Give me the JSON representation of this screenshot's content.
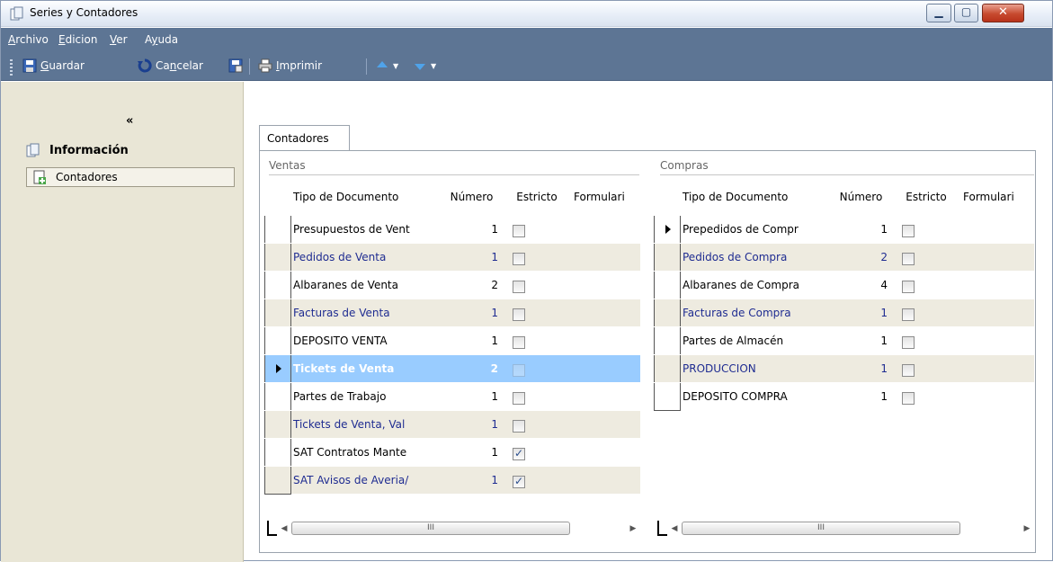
{
  "window": {
    "title": "Series y Contadores",
    "controls": {
      "minimize": "▁",
      "maximize": "▢",
      "close": "✕"
    }
  },
  "menu": [
    {
      "label_pre": "",
      "label_u": "A",
      "label_post": "rchivo"
    },
    {
      "label_pre": "",
      "label_u": "E",
      "label_post": "dicion"
    },
    {
      "label_pre": "",
      "label_u": "V",
      "label_post": "er"
    },
    {
      "label_pre": "A",
      "label_u": "y",
      "label_post": "uda"
    }
  ],
  "toolbar": {
    "guardar": {
      "u": "G",
      "rest": "uardar"
    },
    "cancelar": {
      "pre": "Ca",
      "u": "n",
      "rest": "celar"
    },
    "imprimir": {
      "u": "I",
      "rest": "mprimir"
    }
  },
  "sidebar": {
    "collapse": "«",
    "heading": "Información",
    "items": [
      "Contadores"
    ]
  },
  "tab": {
    "label": "Contadores"
  },
  "ventas": {
    "group": "Ventas",
    "headers": [
      "Tipo de Documento",
      "Número",
      "Estricto",
      "Formulari"
    ],
    "rows": [
      {
        "tipo": "Presupuestos de Vent",
        "num": "1",
        "estricto": false,
        "blue": false,
        "current": false,
        "selected": false
      },
      {
        "tipo": "Pedidos de Venta",
        "num": "1",
        "estricto": false,
        "blue": true,
        "current": false,
        "selected": false
      },
      {
        "tipo": "Albaranes de Venta",
        "num": "2",
        "estricto": false,
        "blue": false,
        "current": false,
        "selected": false
      },
      {
        "tipo": "Facturas de Venta",
        "num": "1",
        "estricto": false,
        "blue": true,
        "current": false,
        "selected": false
      },
      {
        "tipo": "DEPOSITO VENTA",
        "num": "1",
        "estricto": false,
        "blue": false,
        "current": false,
        "selected": false
      },
      {
        "tipo": "Tickets de Venta",
        "num": "2",
        "estricto": false,
        "blue": false,
        "current": true,
        "selected": true
      },
      {
        "tipo": "Partes de Trabajo",
        "num": "1",
        "estricto": false,
        "blue": false,
        "current": false,
        "selected": false
      },
      {
        "tipo": "Tickets de Venta, Val",
        "num": "1",
        "estricto": false,
        "blue": true,
        "current": false,
        "selected": false
      },
      {
        "tipo": "SAT Contratos Mante",
        "num": "1",
        "estricto": true,
        "blue": false,
        "current": false,
        "selected": false
      },
      {
        "tipo": "SAT Avisos de Averia/",
        "num": "1",
        "estricto": true,
        "blue": true,
        "current": false,
        "selected": false
      }
    ]
  },
  "compras": {
    "group": "Compras",
    "headers": [
      "Tipo de Documento",
      "Número",
      "Estricto",
      "Formulari"
    ],
    "rows": [
      {
        "tipo": "Prepedidos de Compr",
        "num": "1",
        "estricto": false,
        "blue": false,
        "current": true,
        "selected": false
      },
      {
        "tipo": "Pedidos de Compra",
        "num": "2",
        "estricto": false,
        "blue": true,
        "current": false,
        "selected": false
      },
      {
        "tipo": "Albaranes de Compra",
        "num": "4",
        "estricto": false,
        "blue": false,
        "current": false,
        "selected": false
      },
      {
        "tipo": "Facturas de Compra",
        "num": "1",
        "estricto": false,
        "blue": true,
        "current": false,
        "selected": false
      },
      {
        "tipo": "Partes de Almacén",
        "num": "1",
        "estricto": false,
        "blue": false,
        "current": false,
        "selected": false
      },
      {
        "tipo": "PRODUCCION",
        "num": "1",
        "estricto": false,
        "blue": true,
        "current": false,
        "selected": false
      },
      {
        "tipo": "DEPOSITO COMPRA",
        "num": "1",
        "estricto": false,
        "blue": false,
        "current": false,
        "selected": false
      }
    ]
  },
  "scroll": {
    "left": "◀",
    "right": "▶",
    "grip": "III"
  },
  "colors": {
    "menubar": "#5d7594",
    "sidebar": "#e9e6d6",
    "selection": "#99ccff",
    "blue_text": "#1f2c91"
  }
}
